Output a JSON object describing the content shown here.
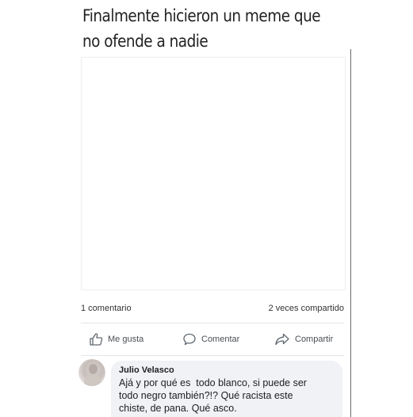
{
  "post": {
    "title_lines": [
      "Finalmente hicieron un meme que",
      "no ofende a nadie"
    ]
  },
  "stats": {
    "comments": "1 comentario",
    "shares": "2 veces compartido"
  },
  "actions": {
    "like_label": "Me gusta",
    "comment_label": "Comentar",
    "share_label": "Compartir",
    "like_icon": "thumbs-up-icon",
    "comment_icon": "speech-bubble-icon",
    "share_icon": "share-arrow-icon"
  },
  "comment": {
    "author": "Julio Velasco",
    "lines": [
      "Ajá y por qué es  todo blanco, si puede ser",
      "todo negro también?!? Qué racista este",
      "chiste, de pana. Qué asco."
    ]
  },
  "colors": {
    "bubble_bg": "#f0f2f5",
    "action_text": "#4b4f56",
    "divider": "#e4e6eb"
  }
}
